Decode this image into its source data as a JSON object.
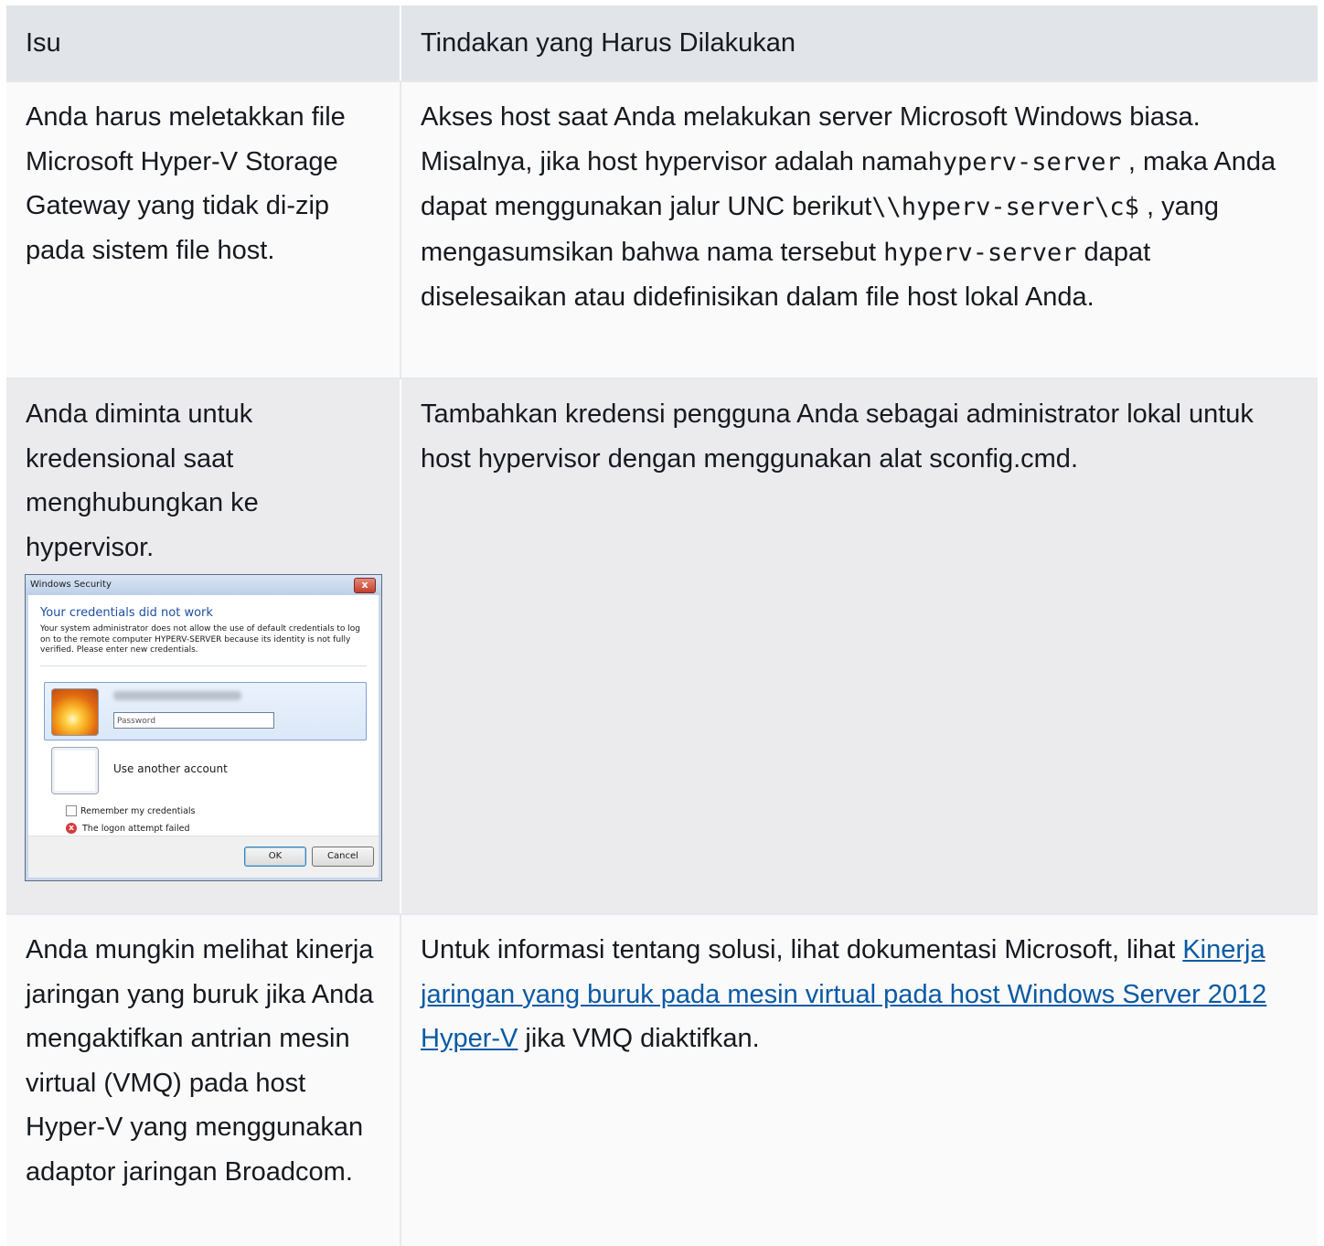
{
  "header": {
    "col1": "Isu",
    "col2": "Tindakan yang Harus Dilakukan"
  },
  "rows": [
    {
      "issue": "Anda harus meletakkan file Microsoft Hyper-V Storage Gateway yang tidak di-zip pada sistem file host.",
      "action_parts": {
        "t1": "Akses host saat Anda melakukan server Microsoft Windows biasa. Misalnya, jika host hypervisor adalah nama",
        "code1": "hyperv-server",
        "t2": " , maka Anda dapat menggunakan jalur UNC berikut",
        "code2": "\\\\hyperv-server\\c$",
        "t3": " , yang mengasumsikan bahwa nama tersebut ",
        "code3": "hyperv-server",
        "t4": " dapat diselesaikan atau didefinisikan dalam file host lokal Anda."
      }
    },
    {
      "issue": "Anda diminta untuk kredensional saat menghubungkan ke hypervisor.",
      "action": "Tambahkan kredensi pengguna Anda sebagai administrator lokal untuk host hypervisor dengan menggunakan alat sconfig.cmd."
    },
    {
      "issue": "Anda mungkin melihat kinerja jaringan yang buruk jika Anda mengaktifkan antrian mesin virtual (VMQ) pada host Hyper-V yang menggunakan adaptor jaringan Broadcom.",
      "action_parts": {
        "t1": "Untuk informasi tentang solusi, lihat dokumentasi Microsoft, lihat ",
        "link": "Kinerja jaringan yang buruk pada mesin virtual pada host Windows Server 2012 Hyper-V",
        "t2": " jika VMQ diaktifkan."
      }
    }
  ],
  "dialog": {
    "title": "Windows Security",
    "close_glyph": "x",
    "heading": "Your credentials did not work",
    "message": "Your system administrator does not allow the use of default credentials to log on to the remote computer HYPERV-SERVER because its identity is not fully verified. Please enter new credentials.",
    "password_placeholder": "Password",
    "use_another": "Use another account",
    "remember": "Remember my credentials",
    "error": "The logon attempt failed",
    "error_glyph": "x",
    "ok": "OK",
    "cancel": "Cancel"
  },
  "colors": {
    "header_bg": "#e1e4e8",
    "row_light": "#fafafa",
    "row_dark": "#ebebee",
    "link": "#0a5aa5"
  }
}
